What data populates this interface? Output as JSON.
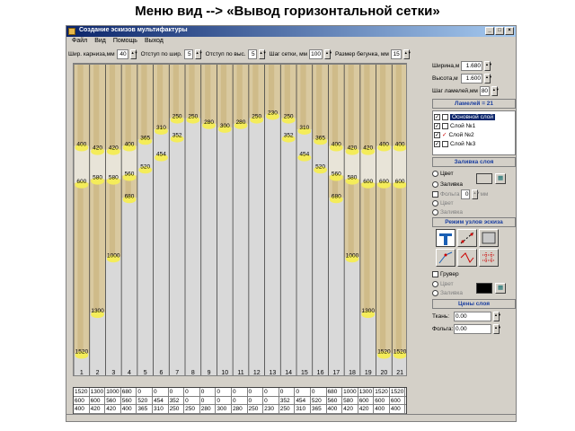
{
  "slide_title": "Меню вид --> «Вывод горизонтальной сетки»",
  "window": {
    "title": "Создание эскизов мультифактуры"
  },
  "menu": [
    "Файл",
    "Вид",
    "Помощь",
    "Выход"
  ],
  "toolbar": {
    "cornice_label": "Шир. карниза,мм",
    "cornice_value": "40",
    "offset_w_label": "Отступ по шир.",
    "offset_w_value": "5",
    "offset_h_label": "Отступ по выс.",
    "offset_h_value": "5",
    "grid_step_label": "Шаг сетки, мм",
    "grid_step_value": "100",
    "slider_label": "Размер бегунка, мм",
    "slider_value": "15"
  },
  "panel": {
    "width_label": "Ширина,м",
    "width_value": "1.680",
    "height_label": "Высота,м",
    "height_value": "1.600",
    "lamella_step_label": "Шаг ламелей,мм",
    "lamella_step_value": "80",
    "lamella_count": "Ламелей = 21",
    "layers": [
      {
        "label": "Основной слой",
        "selected": true
      },
      {
        "label": "Слой №1",
        "selected": false
      },
      {
        "label": "Слой №2",
        "selected": false
      },
      {
        "label": "Слой №3",
        "selected": false
      }
    ],
    "fill_section": "Заливка слоя",
    "color_radio": "Цвет",
    "fill_radio": "Заливка",
    "foil_label": "Фольга",
    "foil_value": "0",
    "foil_unit": "мм",
    "color_radio2": "Цвет",
    "fill_radio2": "Заливка",
    "mode_section": "Режим узлов эскиза",
    "gruver_label": "Грувер",
    "color_radio3": "Цвет",
    "fill_radio3": "Заливка",
    "price_section": "Цены слоя",
    "fabric_label": "Ткань:",
    "fabric_value": "0.00",
    "foil_price_label": "Фольга:",
    "foil_price_value": "0.00"
  },
  "lamella_numbers": [
    "1",
    "2",
    "3",
    "4",
    "5",
    "6",
    "7",
    "8",
    "9",
    "10",
    "11",
    "12",
    "13",
    "14",
    "15",
    "16",
    "17",
    "18",
    "19",
    "20",
    "21"
  ],
  "top_heights": [
    "400",
    "420",
    "420",
    "400",
    "365",
    "310",
    "250",
    "250",
    "280",
    "300",
    "280",
    "250",
    "230",
    "250",
    "310",
    "365",
    "400",
    "420",
    "420",
    "400",
    "400"
  ],
  "mid_heights": [
    "600",
    "580",
    "580",
    "560",
    "520",
    "454",
    "352",
    "0",
    "0",
    "0",
    "0",
    "0",
    "0",
    "352",
    "454",
    "520",
    "560",
    "580",
    "600",
    "600",
    "600"
  ],
  "bottom_heights": [
    "1520",
    "1300",
    "1000",
    "680",
    "0",
    "0",
    "0",
    "0",
    "0",
    "0",
    "0",
    "0",
    "0",
    "0",
    "0",
    "0",
    "680",
    "1000",
    "1300",
    "1520",
    "1520"
  ],
  "grid_rows": [
    [
      "1520",
      "1300",
      "1000",
      "680",
      "0",
      "0",
      "0",
      "0",
      "0",
      "0",
      "0",
      "0",
      "0",
      "0",
      "0",
      "0",
      "680",
      "1000",
      "1300",
      "1520",
      "1520"
    ],
    [
      "600",
      "600",
      "560",
      "560",
      "520",
      "454",
      "352",
      "0",
      "0",
      "0",
      "0",
      "0",
      "0",
      "352",
      "454",
      "520",
      "560",
      "580",
      "600",
      "600",
      "600"
    ],
    [
      "400",
      "420",
      "420",
      "400",
      "365",
      "310",
      "250",
      "250",
      "280",
      "300",
      "280",
      "250",
      "230",
      "250",
      "310",
      "365",
      "400",
      "420",
      "420",
      "400",
      "400"
    ]
  ]
}
